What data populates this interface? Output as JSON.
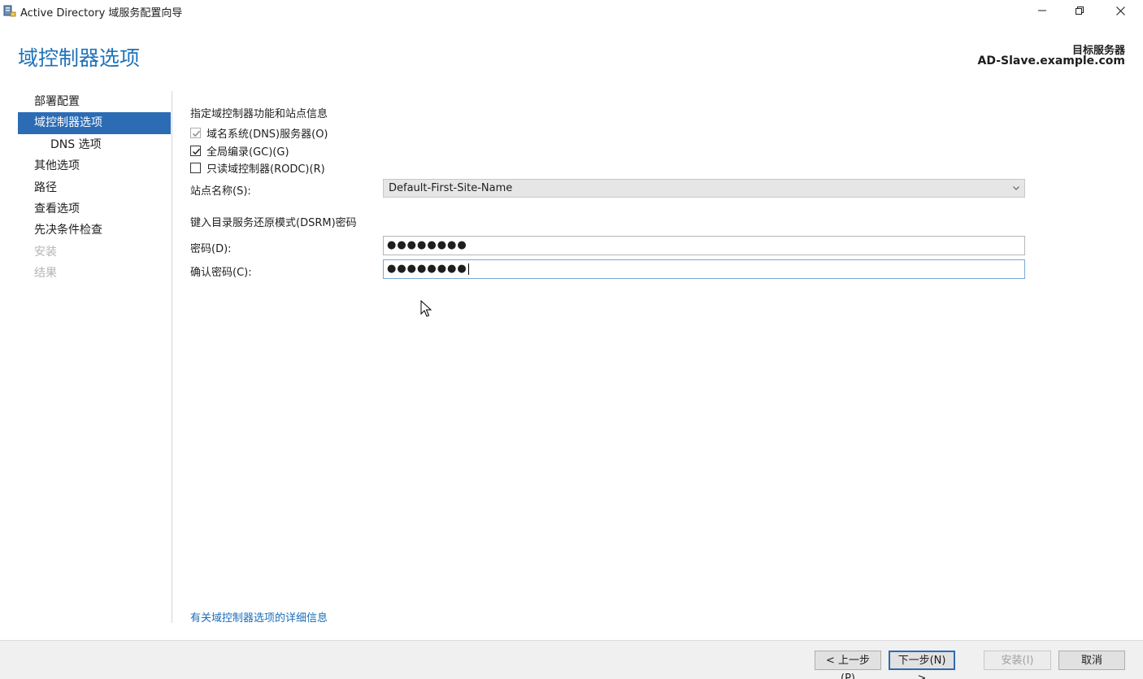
{
  "window": {
    "title": "Active Directory 域服务配置向导",
    "icons": {
      "app": "server-wizard-icon",
      "minimize": "minimize-icon",
      "restore": "restore-icon",
      "close": "close-icon"
    }
  },
  "header": {
    "page_title": "域控制器选项",
    "target_label": "目标服务器",
    "target_server": "AD-Slave.example.com"
  },
  "sidebar": {
    "items": [
      {
        "label": "部署配置",
        "state": "normal"
      },
      {
        "label": "域控制器选项",
        "state": "active"
      },
      {
        "label": "DNS 选项",
        "state": "sub"
      },
      {
        "label": "其他选项",
        "state": "normal"
      },
      {
        "label": "路径",
        "state": "normal"
      },
      {
        "label": "查看选项",
        "state": "normal"
      },
      {
        "label": "先决条件检查",
        "state": "normal"
      },
      {
        "label": "安装",
        "state": "disabled"
      },
      {
        "label": "结果",
        "state": "disabled"
      }
    ]
  },
  "content": {
    "section_heading": "指定域控制器功能和站点信息",
    "checkboxes": [
      {
        "label": "域名系统(DNS)服务器(O)",
        "checked": true,
        "disabled": true
      },
      {
        "label": "全局编录(GC)(G)",
        "checked": true,
        "disabled": false
      },
      {
        "label": "只读域控制器(RODC)(R)",
        "checked": false,
        "disabled": false
      }
    ],
    "site": {
      "label": "站点名称(S):",
      "value": "Default-First-Site-Name"
    },
    "dsrm_heading": "键入目录服务还原模式(DSRM)密码",
    "password": {
      "label": "密码(D):",
      "value": "●●●●●●●●"
    },
    "confirm": {
      "label": "确认密码(C):",
      "value": "●●●●●●●●"
    },
    "more_info_link": "有关域控制器选项的详细信息"
  },
  "buttons": {
    "back": "< 上一步(P)",
    "next": "下一步(N) >",
    "install": "安装(I)",
    "cancel": "取消"
  },
  "colors": {
    "accent": "#2b6cb5",
    "title": "#1e73b9",
    "link": "#1a6db8"
  }
}
